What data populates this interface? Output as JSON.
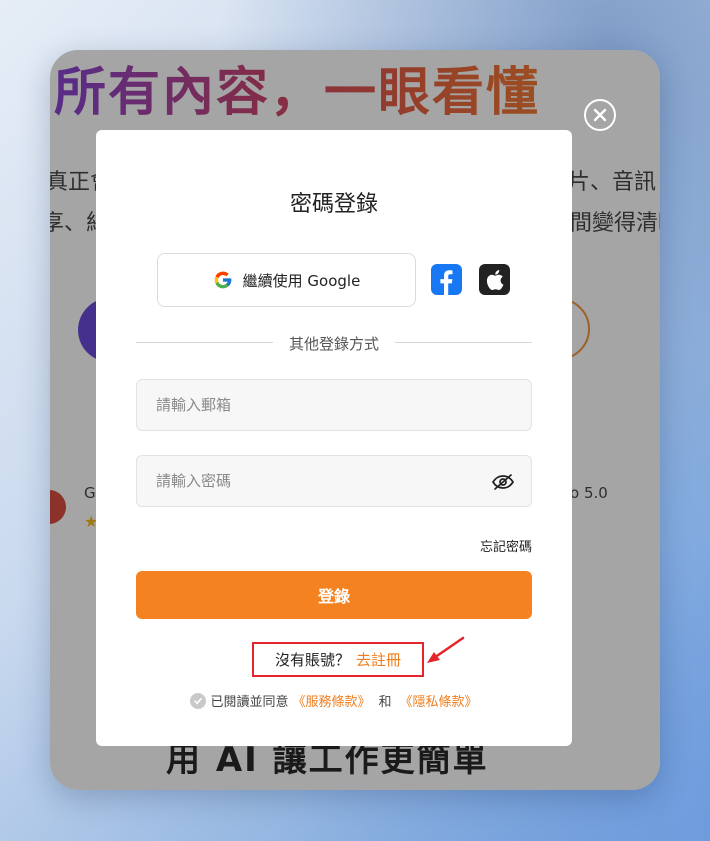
{
  "backdrop": {
    "headline": "所有內容，一眼看懂",
    "line1_left": "真正會",
    "line1_right": "片、音訊",
    "line2_left": "享、紀",
    "line2_right": "間變得清晰",
    "review_g": "G",
    "review_score": "o  5.0",
    "bottom_headline": "用 AI 讓工作更簡單"
  },
  "modal": {
    "title": "密碼登錄",
    "google_label": "繼續使用 Google",
    "divider_text": "其他登錄方式",
    "email_placeholder": "請輸入郵箱",
    "password_placeholder": "請輸入密碼",
    "forgot_label": "忘記密碼",
    "login_label": "登錄",
    "no_account_text": "沒有賬號？",
    "register_label": "去註冊",
    "agree_prefix": "已閱讀並同意",
    "terms_label": "《服務條款》",
    "and_text": "和",
    "privacy_label": "《隱私條款》"
  },
  "colors": {
    "accent": "#f58220",
    "link": "#f07d1d",
    "highlight_box": "#e5242b",
    "facebook": "#1877f2",
    "apple": "#222222"
  }
}
